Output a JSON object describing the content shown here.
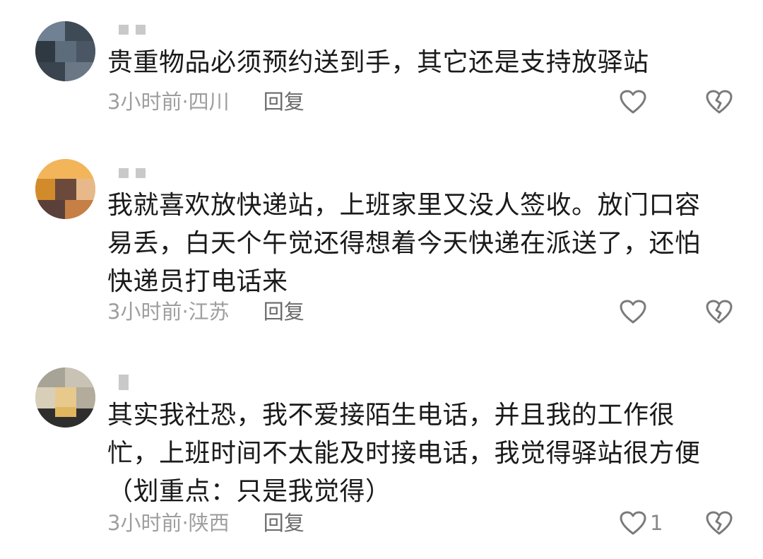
{
  "comments": [
    {
      "text_lines": [
        "贵重物品必须预约送到手，其它还是支持放驿站"
      ],
      "time": "3小时前",
      "location": "四川",
      "reply_label": "回复",
      "like_count": ""
    },
    {
      "text_lines": [
        "我就喜欢放快递站，上班家里又没人签收。放门口容",
        "易丢，白天个午觉还得想着今天快递在派送了，还怕",
        "快递员打电话来"
      ],
      "time": "3小时前",
      "location": "江苏",
      "reply_label": "回复",
      "like_count": ""
    },
    {
      "text_lines": [
        "其实我社恐，我不爱接陌生电话，并且我的工作很",
        "忙，上班时间不太能及时接电话，我觉得驿站很方便",
        "（划重点：只是我觉得）"
      ],
      "time": "3小时前",
      "location": "陕西",
      "reply_label": "回复",
      "like_count": "1"
    }
  ],
  "separator": " · ",
  "icons": {
    "like": "heart-outline-icon",
    "dislike": "broken-heart-icon"
  },
  "colors": {
    "text": "#1a1a1a",
    "meta": "#9e9e9e",
    "reply": "#6a6a6a",
    "icon": "#7a7a7a"
  }
}
